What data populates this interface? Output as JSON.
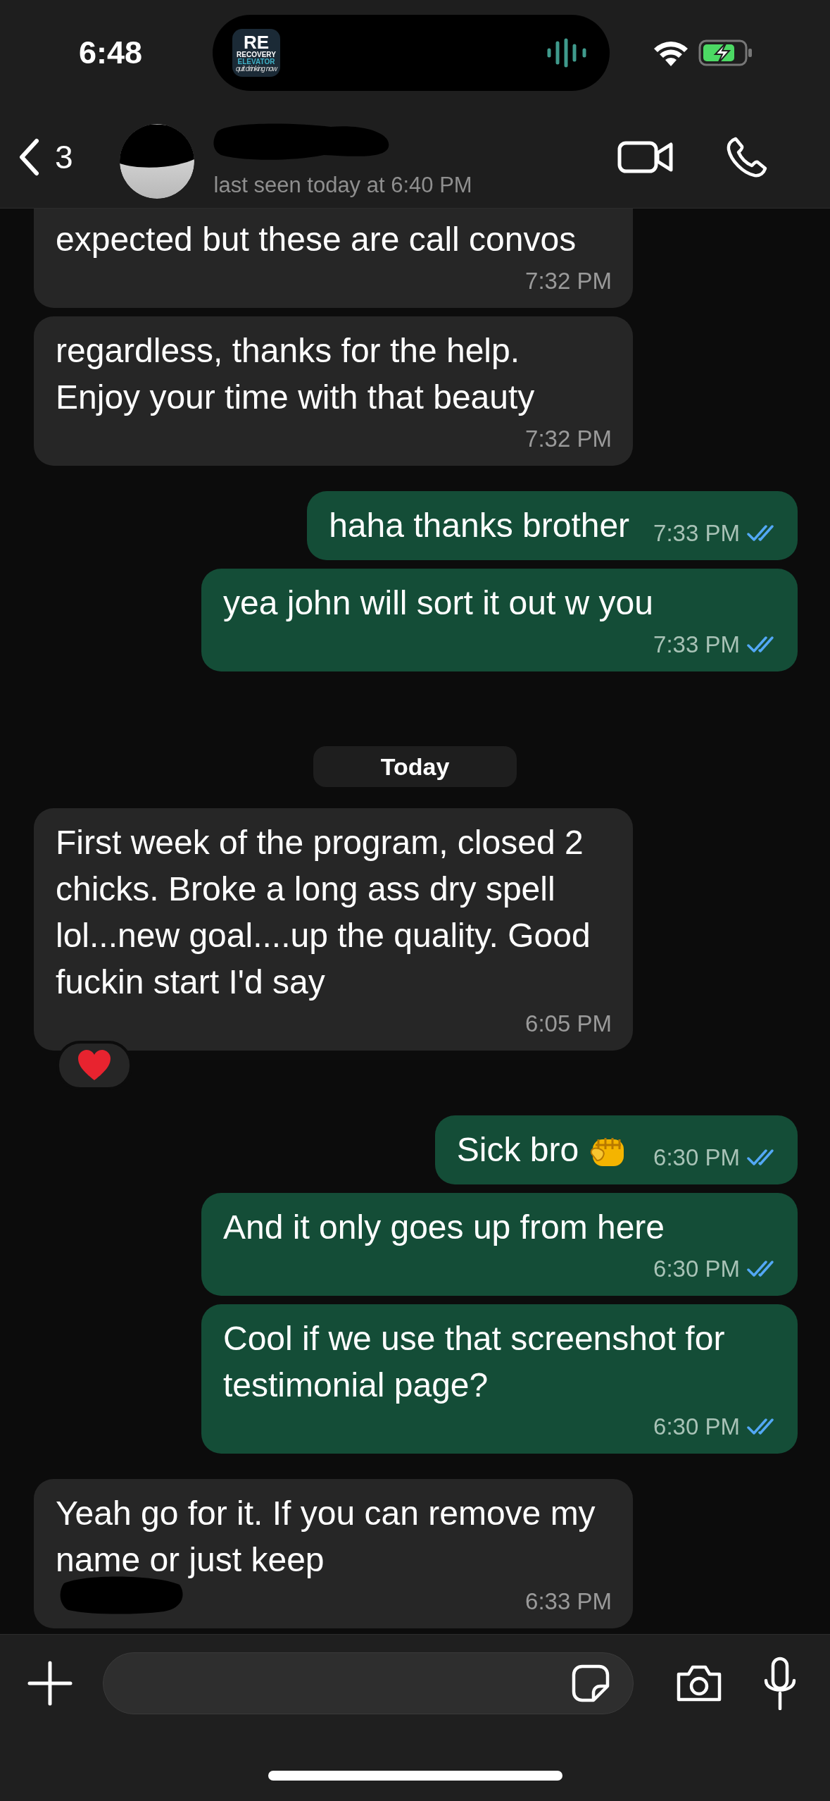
{
  "status_bar": {
    "time": "6:48",
    "charging": true,
    "app_icon": {
      "monogram": "RE",
      "name": "RECOVERY",
      "name_2": "ELEVATOR",
      "tagline": "quit drinking now"
    }
  },
  "header": {
    "back_count": "3",
    "subtitle": "last seen today at 6:40 PM"
  },
  "messages": [
    {
      "kind": "message",
      "sent": false,
      "text": "expected but these are call convos",
      "time": "7:32 PM"
    },
    {
      "kind": "message",
      "sent": false,
      "text": "regardless, thanks for the help. Enjoy your time with that beauty",
      "time": "7:32 PM"
    },
    {
      "kind": "message",
      "sent": true,
      "text": "haha thanks brother",
      "time": "7:33 PM",
      "read": true
    },
    {
      "kind": "message",
      "sent": true,
      "text": "yea john will sort it out w you",
      "time": "7:33 PM",
      "read": true
    },
    {
      "kind": "date",
      "text": "Today"
    },
    {
      "kind": "message",
      "sent": false,
      "text": "First week of the program, closed 2 chicks. Broke a long ass dry spell lol...new goal....up the quality. Good fuckin start I'd say",
      "time": "6:05 PM",
      "reaction": true
    },
    {
      "kind": "message",
      "sent": true,
      "text": "Sick bro",
      "emoji": true,
      "time": "6:30 PM",
      "read": true
    },
    {
      "kind": "message",
      "sent": true,
      "text": "And it only goes up from here",
      "time": "6:30 PM",
      "read": true
    },
    {
      "kind": "message",
      "sent": true,
      "text": "Cool if we use that screenshot for testimonial page?",
      "time": "6:30 PM",
      "read": true
    },
    {
      "kind": "message",
      "sent": false,
      "text": "Yeah go for it. If you can remove my name or just keep",
      "time": "6:33 PM",
      "redacted": true
    }
  ]
}
